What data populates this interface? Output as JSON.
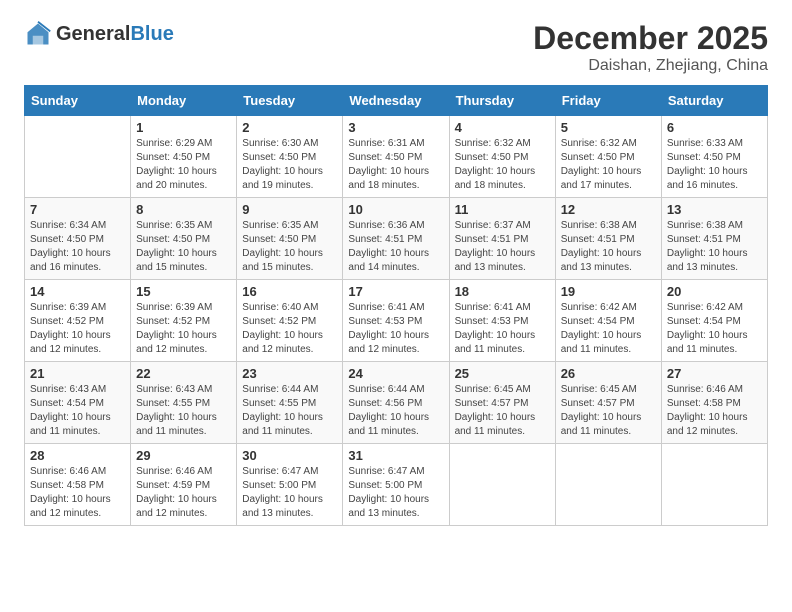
{
  "header": {
    "logo": {
      "general": "General",
      "blue": "Blue"
    },
    "title": "December 2025",
    "location": "Daishan, Zhejiang, China"
  },
  "days_of_week": [
    "Sunday",
    "Monday",
    "Tuesday",
    "Wednesday",
    "Thursday",
    "Friday",
    "Saturday"
  ],
  "weeks": [
    [
      {
        "day": "",
        "info": ""
      },
      {
        "day": "1",
        "info": "Sunrise: 6:29 AM\nSunset: 4:50 PM\nDaylight: 10 hours and 20 minutes."
      },
      {
        "day": "2",
        "info": "Sunrise: 6:30 AM\nSunset: 4:50 PM\nDaylight: 10 hours and 19 minutes."
      },
      {
        "day": "3",
        "info": "Sunrise: 6:31 AM\nSunset: 4:50 PM\nDaylight: 10 hours and 18 minutes."
      },
      {
        "day": "4",
        "info": "Sunrise: 6:32 AM\nSunset: 4:50 PM\nDaylight: 10 hours and 18 minutes."
      },
      {
        "day": "5",
        "info": "Sunrise: 6:32 AM\nSunset: 4:50 PM\nDaylight: 10 hours and 17 minutes."
      },
      {
        "day": "6",
        "info": "Sunrise: 6:33 AM\nSunset: 4:50 PM\nDaylight: 10 hours and 16 minutes."
      }
    ],
    [
      {
        "day": "7",
        "info": "Sunrise: 6:34 AM\nSunset: 4:50 PM\nDaylight: 10 hours and 16 minutes."
      },
      {
        "day": "8",
        "info": "Sunrise: 6:35 AM\nSunset: 4:50 PM\nDaylight: 10 hours and 15 minutes."
      },
      {
        "day": "9",
        "info": "Sunrise: 6:35 AM\nSunset: 4:50 PM\nDaylight: 10 hours and 15 minutes."
      },
      {
        "day": "10",
        "info": "Sunrise: 6:36 AM\nSunset: 4:51 PM\nDaylight: 10 hours and 14 minutes."
      },
      {
        "day": "11",
        "info": "Sunrise: 6:37 AM\nSunset: 4:51 PM\nDaylight: 10 hours and 13 minutes."
      },
      {
        "day": "12",
        "info": "Sunrise: 6:38 AM\nSunset: 4:51 PM\nDaylight: 10 hours and 13 minutes."
      },
      {
        "day": "13",
        "info": "Sunrise: 6:38 AM\nSunset: 4:51 PM\nDaylight: 10 hours and 13 minutes."
      }
    ],
    [
      {
        "day": "14",
        "info": "Sunrise: 6:39 AM\nSunset: 4:52 PM\nDaylight: 10 hours and 12 minutes."
      },
      {
        "day": "15",
        "info": "Sunrise: 6:39 AM\nSunset: 4:52 PM\nDaylight: 10 hours and 12 minutes."
      },
      {
        "day": "16",
        "info": "Sunrise: 6:40 AM\nSunset: 4:52 PM\nDaylight: 10 hours and 12 minutes."
      },
      {
        "day": "17",
        "info": "Sunrise: 6:41 AM\nSunset: 4:53 PM\nDaylight: 10 hours and 12 minutes."
      },
      {
        "day": "18",
        "info": "Sunrise: 6:41 AM\nSunset: 4:53 PM\nDaylight: 10 hours and 11 minutes."
      },
      {
        "day": "19",
        "info": "Sunrise: 6:42 AM\nSunset: 4:54 PM\nDaylight: 10 hours and 11 minutes."
      },
      {
        "day": "20",
        "info": "Sunrise: 6:42 AM\nSunset: 4:54 PM\nDaylight: 10 hours and 11 minutes."
      }
    ],
    [
      {
        "day": "21",
        "info": "Sunrise: 6:43 AM\nSunset: 4:54 PM\nDaylight: 10 hours and 11 minutes."
      },
      {
        "day": "22",
        "info": "Sunrise: 6:43 AM\nSunset: 4:55 PM\nDaylight: 10 hours and 11 minutes."
      },
      {
        "day": "23",
        "info": "Sunrise: 6:44 AM\nSunset: 4:55 PM\nDaylight: 10 hours and 11 minutes."
      },
      {
        "day": "24",
        "info": "Sunrise: 6:44 AM\nSunset: 4:56 PM\nDaylight: 10 hours and 11 minutes."
      },
      {
        "day": "25",
        "info": "Sunrise: 6:45 AM\nSunset: 4:57 PM\nDaylight: 10 hours and 11 minutes."
      },
      {
        "day": "26",
        "info": "Sunrise: 6:45 AM\nSunset: 4:57 PM\nDaylight: 10 hours and 11 minutes."
      },
      {
        "day": "27",
        "info": "Sunrise: 6:46 AM\nSunset: 4:58 PM\nDaylight: 10 hours and 12 minutes."
      }
    ],
    [
      {
        "day": "28",
        "info": "Sunrise: 6:46 AM\nSunset: 4:58 PM\nDaylight: 10 hours and 12 minutes."
      },
      {
        "day": "29",
        "info": "Sunrise: 6:46 AM\nSunset: 4:59 PM\nDaylight: 10 hours and 12 minutes."
      },
      {
        "day": "30",
        "info": "Sunrise: 6:47 AM\nSunset: 5:00 PM\nDaylight: 10 hours and 13 minutes."
      },
      {
        "day": "31",
        "info": "Sunrise: 6:47 AM\nSunset: 5:00 PM\nDaylight: 10 hours and 13 minutes."
      },
      {
        "day": "",
        "info": ""
      },
      {
        "day": "",
        "info": ""
      },
      {
        "day": "",
        "info": ""
      }
    ]
  ]
}
